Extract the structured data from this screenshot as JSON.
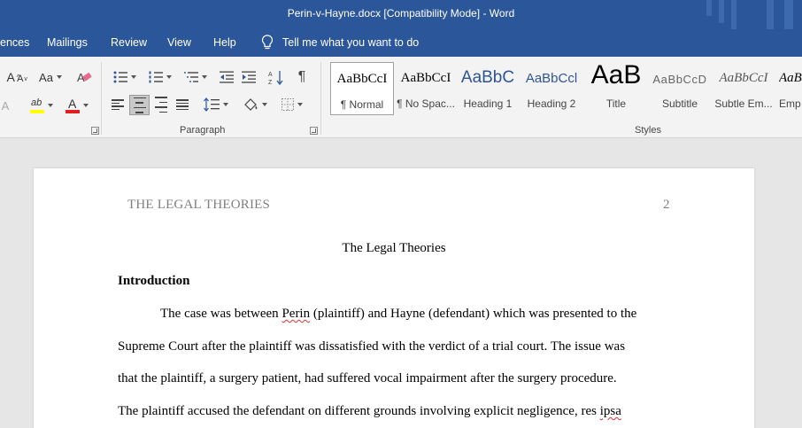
{
  "window": {
    "title": "Perin-v-Hayne.docx [Compatibility Mode]  -  Word"
  },
  "tabs": {
    "items": [
      {
        "label": "ences"
      },
      {
        "label": "Mailings"
      },
      {
        "label": "Review"
      },
      {
        "label": "View"
      },
      {
        "label": "Help"
      }
    ],
    "tell_me": "Tell me what you want to do"
  },
  "ribbon": {
    "paragraph_group": "Paragraph",
    "styles_group": "Styles",
    "font_case_label": "Aa",
    "grow_font_label": "A",
    "highlight_label": "ab",
    "font_color_label": "A",
    "colors": {
      "highlight": "#ffff00",
      "font_color": "#e02020",
      "accent": "#2b579a"
    },
    "styles": [
      {
        "preview": "AaBbCcI",
        "name": "¶ Normal",
        "active": true
      },
      {
        "preview": "AaBbCcI",
        "name": "¶ No Spac..."
      },
      {
        "preview": "AaBbC",
        "name": "Heading 1"
      },
      {
        "preview": "AaBbCcl",
        "name": "Heading 2"
      },
      {
        "preview": "AaB",
        "name": "Title"
      },
      {
        "preview": "AaBbCcD",
        "name": "Subtitle"
      },
      {
        "preview": "AaBbCcI",
        "name": "Subtle Em..."
      },
      {
        "preview": "AaB",
        "name": "Emp"
      }
    ]
  },
  "document": {
    "header_left": "THE LEGAL THEORIES",
    "header_page": "2",
    "title": "The Legal Theories",
    "heading": "Introduction",
    "lines": [
      [
        "The case was between ",
        "Perin",
        " (plaintiff) and Hayne (defendant) which was presented to the"
      ],
      [
        "Supreme Court after the plaintiff was dissatisfied with the verdict of a trial court. The issue was"
      ],
      [
        "that the plaintiff, a surgery patient, had suffered vocal impairment after the surgery procedure."
      ],
      [
        "The plaintiff accused the defendant on different grounds involving explicit negligence, res ",
        "ipsa",
        ""
      ]
    ]
  }
}
